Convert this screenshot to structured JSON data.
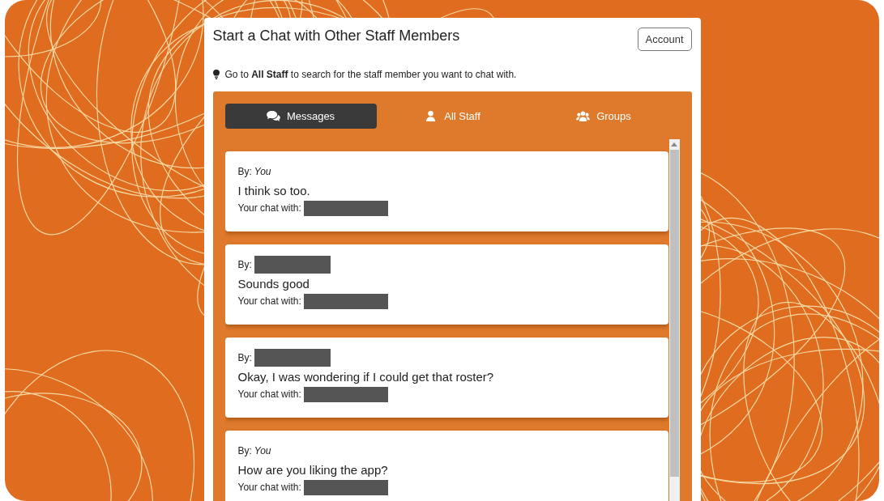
{
  "header": {
    "title": "Start a Chat with Other Staff Members",
    "account_button": "Account"
  },
  "hint": "Go to **All Staff** to search for the staff member you want to chat with.",
  "tabs": [
    {
      "label": "Messages",
      "kind": "chat",
      "selected": true
    },
    {
      "label": "All Staff",
      "kind": "person",
      "selected": false
    },
    {
      "label": "Groups",
      "kind": "people",
      "selected": false
    }
  ],
  "messages": [
    {
      "by_label": "By:",
      "author": {
        "kind": "you",
        "text": "You"
      },
      "text": "I think so too.",
      "chat_with_label": "Your chat with:",
      "chat_with": {
        "kind": "redacted"
      }
    },
    {
      "by_label": "By:",
      "author": {
        "kind": "redacted"
      },
      "text": "Sounds good",
      "chat_with_label": "Your chat with:",
      "chat_with": {
        "kind": "redacted"
      }
    },
    {
      "by_label": "By:",
      "author": {
        "kind": "redacted"
      },
      "text": "Okay, I was wondering if I could get that roster?",
      "chat_with_label": "Your chat with:",
      "chat_with": {
        "kind": "redacted"
      }
    },
    {
      "by_label": "By:",
      "author": {
        "kind": "you",
        "text": "You"
      },
      "text": "How are you liking the app?",
      "chat_with_label": "Your chat with:",
      "chat_with": {
        "kind": "redacted"
      }
    }
  ]
}
